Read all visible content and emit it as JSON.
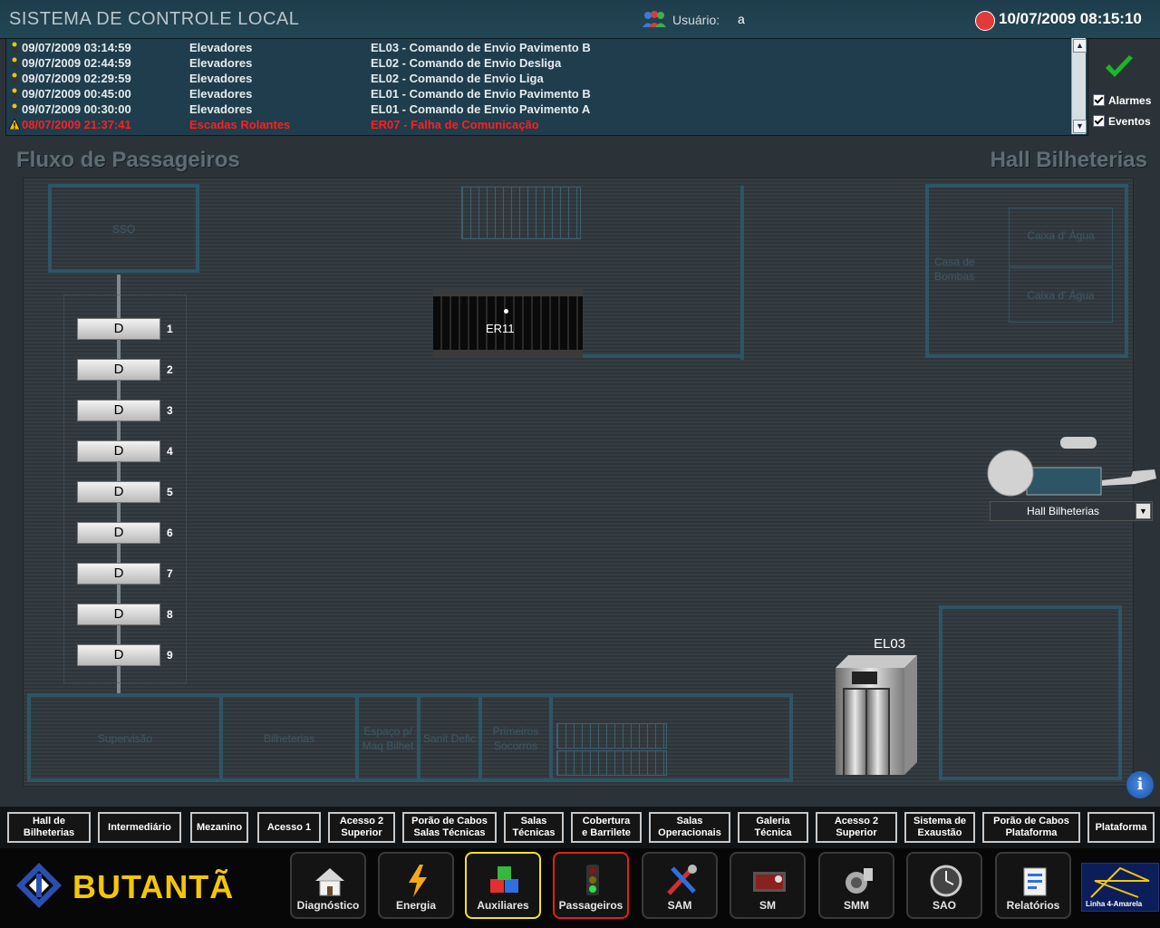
{
  "header": {
    "title": "SISTEMA DE CONTROLE LOCAL",
    "user_label": "Usuário:",
    "user_value": "a",
    "datetime": "10/07/2009 08:15:10"
  },
  "events": [
    {
      "time": "09/07/2009 03:14:59",
      "system": "Elevadores",
      "message": "EL03 - Comando de Envio Pavimento B",
      "type": "event"
    },
    {
      "time": "09/07/2009 02:44:59",
      "system": "Elevadores",
      "message": "EL02 - Comando de Envio Desliga",
      "type": "event"
    },
    {
      "time": "09/07/2009 02:29:59",
      "system": "Elevadores",
      "message": "EL02 - Comando de Envio Liga",
      "type": "event"
    },
    {
      "time": "09/07/2009 00:45:00",
      "system": "Elevadores",
      "message": "EL01 - Comando de Envio Pavimento B",
      "type": "event"
    },
    {
      "time": "09/07/2009 00:30:00",
      "system": "Elevadores",
      "message": "EL01 - Comando de Envio Pavimento A",
      "type": "event"
    },
    {
      "time": "08/07/2009 21:37:41",
      "system": "Escadas Rolantes",
      "message": "ER07 - Falha de Comunicação",
      "type": "alarm"
    }
  ],
  "filters": {
    "alarms_label": "Alarmes",
    "events_label": "Eventos",
    "alarms_checked": true,
    "events_checked": true
  },
  "main": {
    "title": "Fluxo de Passageiros",
    "area_title": "Hall Bilheterias"
  },
  "plan": {
    "rooms": {
      "sso": "SSO",
      "casa_bombas": "Casa de Bombas",
      "caixa_agua_1": "Caixa d' Água",
      "caixa_agua_2": "Caixa d' Água",
      "supervisao": "Supervisão",
      "bilheterias": "Bilheterias",
      "espaco_maq": "Espaço p/ Maq Bilhet",
      "sanit": "Sanit Defic",
      "primeiros_socorros": "Primeiros Socorros"
    },
    "turnstiles": [
      {
        "state": "D",
        "number": "1"
      },
      {
        "state": "D",
        "number": "2"
      },
      {
        "state": "D",
        "number": "3"
      },
      {
        "state": "D",
        "number": "4"
      },
      {
        "state": "D",
        "number": "5"
      },
      {
        "state": "D",
        "number": "6"
      },
      {
        "state": "D",
        "number": "7"
      },
      {
        "state": "D",
        "number": "8"
      },
      {
        "state": "D",
        "number": "9"
      }
    ],
    "escalator": "ER11",
    "elevator": "EL03",
    "camera_select": "Hall Bilheterias"
  },
  "area_nav": [
    "Hall de\nBilheterias",
    "Intermediário",
    "Mezanino",
    "Acesso 1",
    "Acesso 2\nSuperior",
    "Porão de Cabos\nSalas Técnicas",
    "Salas\nTécnicas",
    "Cobertura\ne Barrilete",
    "Salas\nOperacionais",
    "Galeria\nTécnica",
    "Acesso 2\nSuperior",
    "Sistema de\nExaustão",
    "Porão de Cabos\nPlataforma",
    "Plataforma"
  ],
  "system_nav": {
    "station_name": "BUTANTÃ",
    "items": [
      {
        "label": "Diagnóstico",
        "icon": "house-icon"
      },
      {
        "label": "Energia",
        "icon": "lightning-icon"
      },
      {
        "label": "Auxiliares",
        "icon": "cubes-icon"
      },
      {
        "label": "Passageiros",
        "icon": "traffic-light-icon"
      },
      {
        "label": "SAM",
        "icon": "tools-icon"
      },
      {
        "label": "SM",
        "icon": "monitor-icon"
      },
      {
        "label": "SMM",
        "icon": "speaker-icon"
      },
      {
        "label": "SAO",
        "icon": "clock-icon"
      },
      {
        "label": "Relatórios",
        "icon": "report-icon"
      }
    ],
    "line_logo": "Linha 4-Amarela"
  },
  "colors": {
    "alarm_text": "#ff1f1f",
    "station_name": "#f4c60a",
    "selected_aux": "#f3e322",
    "selected_pass": "#e02020"
  }
}
